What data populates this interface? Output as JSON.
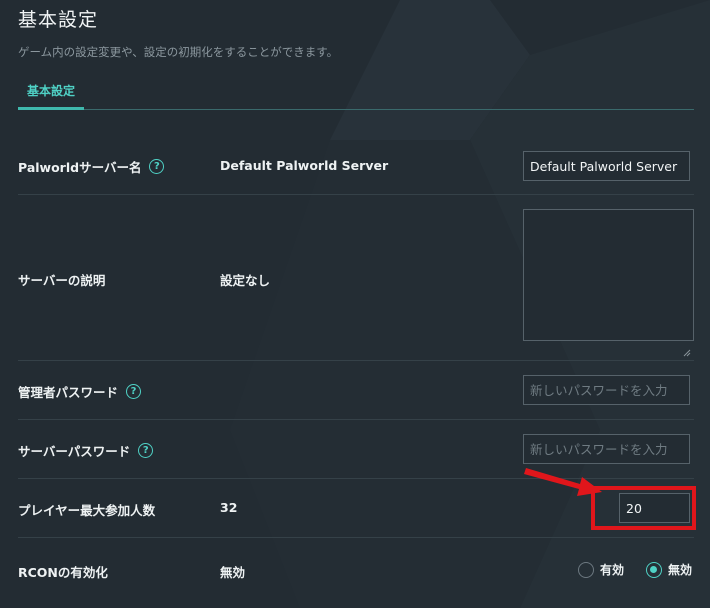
{
  "header": {
    "title": "基本設定",
    "description": "ゲーム内の設定変更や、設定の初期化をすることができます。"
  },
  "tabs": [
    {
      "label": "基本設定",
      "active": true
    }
  ],
  "settings": {
    "server_name": {
      "label": "Palworldサーバー名",
      "current": "Default Palworld Server",
      "input_value": "Default Palworld Server"
    },
    "server_description": {
      "label": "サーバーの説明",
      "current": "設定なし",
      "input_value": ""
    },
    "admin_password": {
      "label": "管理者パスワード",
      "current": "",
      "placeholder": "新しいパスワードを入力"
    },
    "server_password": {
      "label": "サーバーパスワード",
      "current": "",
      "placeholder": "新しいパスワードを入力"
    },
    "max_players": {
      "label": "プレイヤー最大参加人数",
      "current": "32",
      "input_value": "20"
    },
    "rcon": {
      "label": "RCONの有効化",
      "current": "無効",
      "options": [
        {
          "label": "有効",
          "checked": false
        },
        {
          "label": "無効",
          "checked": true
        }
      ]
    }
  },
  "icons": {
    "help": "?"
  },
  "colors": {
    "background": "#232c33",
    "accent": "#4fd1c5",
    "highlight": "#e0161b"
  }
}
